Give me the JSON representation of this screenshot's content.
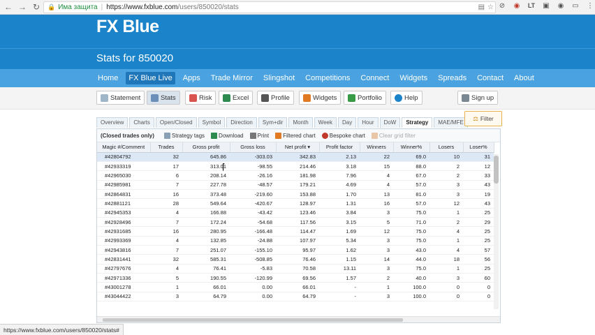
{
  "browser": {
    "back_icon": "back-arrow-icon",
    "forward_icon": "forward-arrow-icon",
    "reload_icon": "reload-icon",
    "secure_label": "Има защита",
    "url_host": "https://www.fxblue.com",
    "url_path": "/users/850020/stats",
    "ext_texts": [
      "LT"
    ]
  },
  "site": {
    "logo_text": "FX Blue",
    "brand_color": "#1a83c9",
    "page_title": "Stats for 850020"
  },
  "menu": {
    "items": [
      "Home",
      "FX Blue Live",
      "Apps",
      "Trade Mirror",
      "Slingshot",
      "Competitions",
      "Connect",
      "Widgets",
      "Spreads",
      "Contact",
      "About"
    ],
    "active": "FX Blue Live"
  },
  "toolbar": {
    "buttons": [
      {
        "label": "Statement",
        "icon": "statement-icon"
      },
      {
        "label": "Stats",
        "icon": "stats-icon",
        "active": true
      },
      {
        "label": "Risk",
        "icon": "risk-icon"
      },
      {
        "label": "Excel",
        "icon": "excel-icon"
      },
      {
        "label": "Profile",
        "icon": "profile-icon"
      },
      {
        "label": "Widgets",
        "icon": "widgets-icon"
      },
      {
        "label": "Portfolio",
        "icon": "portfolio-icon"
      },
      {
        "label": "Help",
        "icon": "help-icon"
      },
      {
        "label": "Sign up",
        "icon": "signup-icon"
      }
    ]
  },
  "tabs": {
    "items": [
      "Overview",
      "Charts",
      "Open/Closed",
      "Symbol",
      "Direction",
      "Sym+dir",
      "Month",
      "Week",
      "Day",
      "Hour",
      "DoW",
      "Strategy",
      "MAE/MFE"
    ],
    "active": "Strategy"
  },
  "filter": {
    "label": "Filter",
    "icon": "filter-icon"
  },
  "grid_tools": {
    "scope": "(Closed trades only)",
    "strategy_tags": "Strategy tags",
    "download": "Download",
    "print": "Print",
    "filtered_chart": "Filtered chart",
    "bespoke_chart": "Bespoke chart",
    "clear_filter": "Clear grid filter"
  },
  "table": {
    "columns": [
      "Magic #/Comment",
      "Trades",
      "Gross profit",
      "Gross loss",
      "Net profit ▾",
      "Profit factor",
      "Winners",
      "Winner%",
      "Losers",
      "Loser%"
    ],
    "rows": [
      [
        "#42804792",
        "32",
        "645.86",
        "-303.03",
        "342.83",
        "2.13",
        "22",
        "69.0",
        "10",
        "31"
      ],
      [
        "#42933319",
        "17",
        "313.01",
        "-98.55",
        "214.46",
        "3.18",
        "15",
        "88.0",
        "2",
        "12"
      ],
      [
        "#42965030",
        "6",
        "208.14",
        "-26.16",
        "181.98",
        "7.96",
        "4",
        "67.0",
        "2",
        "33"
      ],
      [
        "#42985981",
        "7",
        "227.78",
        "-48.57",
        "179.21",
        "4.69",
        "4",
        "57.0",
        "3",
        "43"
      ],
      [
        "#42864831",
        "16",
        "373.48",
        "-219.60",
        "153.88",
        "1.70",
        "13",
        "81.0",
        "3",
        "19"
      ],
      [
        "#42881121",
        "28",
        "549.64",
        "-420.67",
        "128.97",
        "1.31",
        "16",
        "57.0",
        "12",
        "43"
      ],
      [
        "#42945353",
        "4",
        "166.88",
        "-43.42",
        "123.46",
        "3.84",
        "3",
        "75.0",
        "1",
        "25"
      ],
      [
        "#42928496",
        "7",
        "172.24",
        "-54.68",
        "117.56",
        "3.15",
        "5",
        "71.0",
        "2",
        "29"
      ],
      [
        "#42931685",
        "16",
        "280.95",
        "-166.48",
        "114.47",
        "1.69",
        "12",
        "75.0",
        "4",
        "25"
      ],
      [
        "#42993369",
        "4",
        "132.85",
        "-24.88",
        "107.97",
        "5.34",
        "3",
        "75.0",
        "1",
        "25"
      ],
      [
        "#42943816",
        "7",
        "251.07",
        "-155.10",
        "95.97",
        "1.62",
        "3",
        "43.0",
        "4",
        "57"
      ],
      [
        "#42831441",
        "32",
        "585.31",
        "-508.85",
        "76.46",
        "1.15",
        "14",
        "44.0",
        "18",
        "56"
      ],
      [
        "#42797676",
        "4",
        "76.41",
        "-5.83",
        "70.58",
        "13.11",
        "3",
        "75.0",
        "1",
        "25"
      ],
      [
        "#42971336",
        "5",
        "190.55",
        "-120.99",
        "69.56",
        "1.57",
        "2",
        "40.0",
        "3",
        "60"
      ],
      [
        "#43001278",
        "1",
        "66.01",
        "0.00",
        "66.01",
        "-",
        "1",
        "100.0",
        "0",
        "0"
      ],
      [
        "#43044422",
        "3",
        "64.79",
        "0.00",
        "64.79",
        "-",
        "3",
        "100.0",
        "0",
        "0"
      ]
    ]
  },
  "status": {
    "url": "https://www.fxblue.com/users/850020/stats#"
  }
}
